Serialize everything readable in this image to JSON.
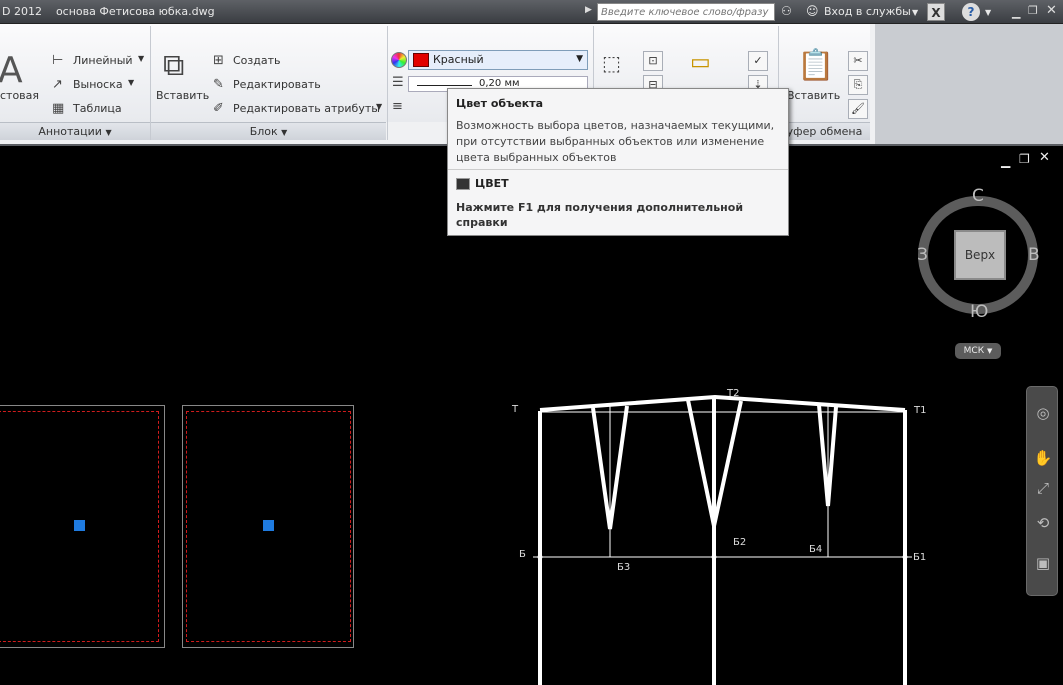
{
  "titlebar": {
    "title": "D 2012    основа Фетисова юбка.dwg",
    "search_placeholder": "Введите ключевое слово/фразу",
    "signin_label": "Вход в службы",
    "exchange_label": "X",
    "help_label": "?"
  },
  "ribbon": {
    "annot": {
      "text_label": "стовая",
      "linear_label": "Линейный",
      "leader_label": "Выноска",
      "table_label": "Таблица",
      "panel_label": "Аннотации"
    },
    "block": {
      "insert_label": "Вставить",
      "create_label": "Создать",
      "edit_label": "Редактировать",
      "edit_attr_label": "Редактировать атрибуты",
      "panel_label": "Блок"
    },
    "properties": {
      "color_value": "Красный",
      "lineweight_value": "0,20 мм"
    },
    "clipboard": {
      "paste_label": "Вставить",
      "panel_label": "уфер обмена"
    }
  },
  "tooltip": {
    "title": "Цвет объекта",
    "description": "Возможность выбора цветов, назначаемых текущими, при отсутствии выбранных объектов или изменение цвета выбранных объектов",
    "command": "ЦВЕТ",
    "help": "Нажмите F1 для получения дополнительной справки"
  },
  "viewcube": {
    "top_label": "Верх",
    "north": "С",
    "south": "Ю",
    "west": "З",
    "east": "В",
    "ucs_label": "МСК"
  },
  "drawing": {
    "labels": {
      "t": "Т",
      "t1": "Т1",
      "t2": "Т2",
      "b": "Б",
      "b1": "Б1",
      "b2": "Б2",
      "b3": "Б3",
      "b4": "Б4"
    }
  },
  "colors": {
    "accent_red": "#e20000",
    "grip_blue": "#1f7be0"
  }
}
